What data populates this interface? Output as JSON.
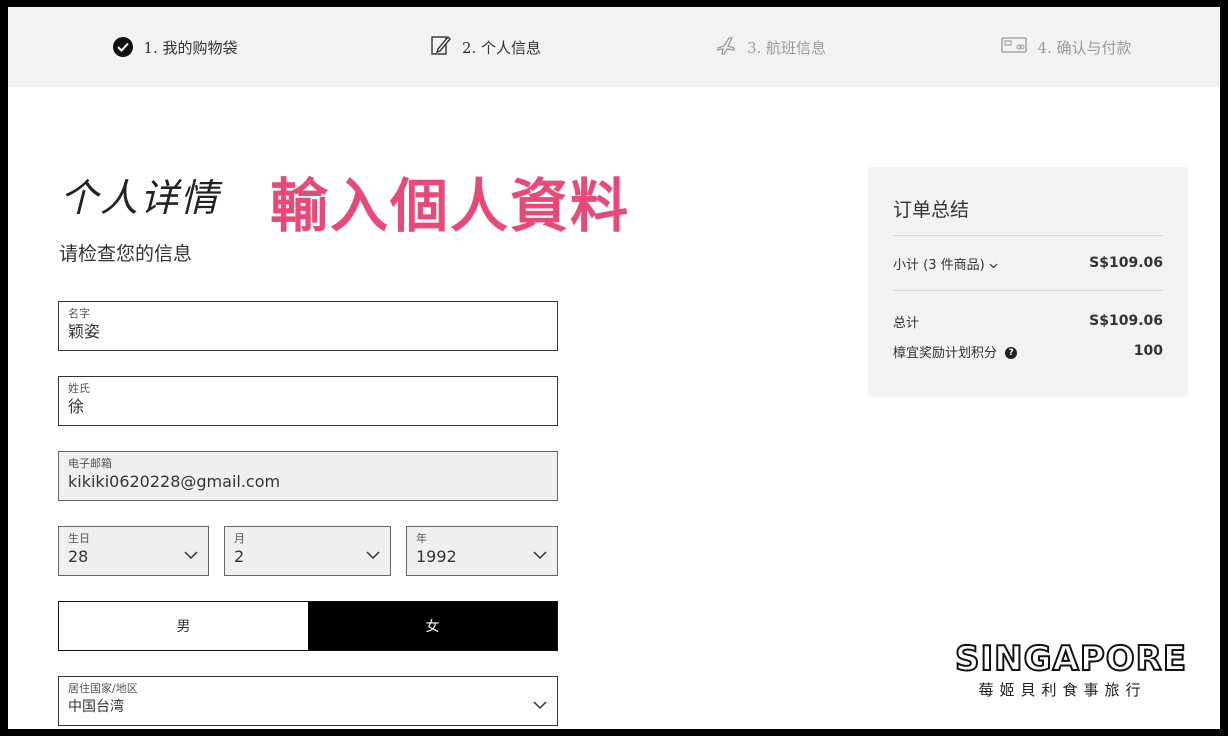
{
  "steps": [
    {
      "num": "1.",
      "label": "我的购物袋",
      "icon": "check-circle-icon"
    },
    {
      "num": "2.",
      "label": "个人信息",
      "icon": "pencil-edit-icon"
    },
    {
      "num": "3.",
      "label": "航班信息",
      "icon": "airplane-icon"
    },
    {
      "num": "4.",
      "label": "确认与付款",
      "icon": "credit-card-icon"
    }
  ],
  "page": {
    "title": "个人详情",
    "overlay": "輸入個人資料",
    "subtitle": "请检查您的信息"
  },
  "form": {
    "first_name": {
      "label": "名字",
      "value": "颖姿"
    },
    "last_name": {
      "label": "姓氏",
      "value": "徐"
    },
    "email": {
      "label": "电子邮箱",
      "value": "kikiki0620228@gmail.com"
    },
    "dob_day": {
      "label": "生日",
      "value": "28"
    },
    "dob_month": {
      "label": "月",
      "value": "2"
    },
    "dob_year": {
      "label": "年",
      "value": "1992"
    },
    "gender": {
      "male": "男",
      "female": "女",
      "selected": "female"
    },
    "country": {
      "label": "居住国家/地区",
      "value": "中国台湾"
    }
  },
  "summary": {
    "title": "订单总结",
    "subtotal_label": "小计 (3 件商品)",
    "subtotal_value": "S$109.06",
    "total_label": "总计",
    "total_value": "S$109.06",
    "points_label": "樟宜奖励计划积分",
    "points_value": "100"
  },
  "logo": {
    "main": "SINGAPORE",
    "sub": "莓姬貝利食事旅行"
  },
  "colors": {
    "overlay": "#e84a78",
    "stepper_bg": "#f2f2f2",
    "summary_bg": "#f2f2f2",
    "selected": "#000000"
  }
}
